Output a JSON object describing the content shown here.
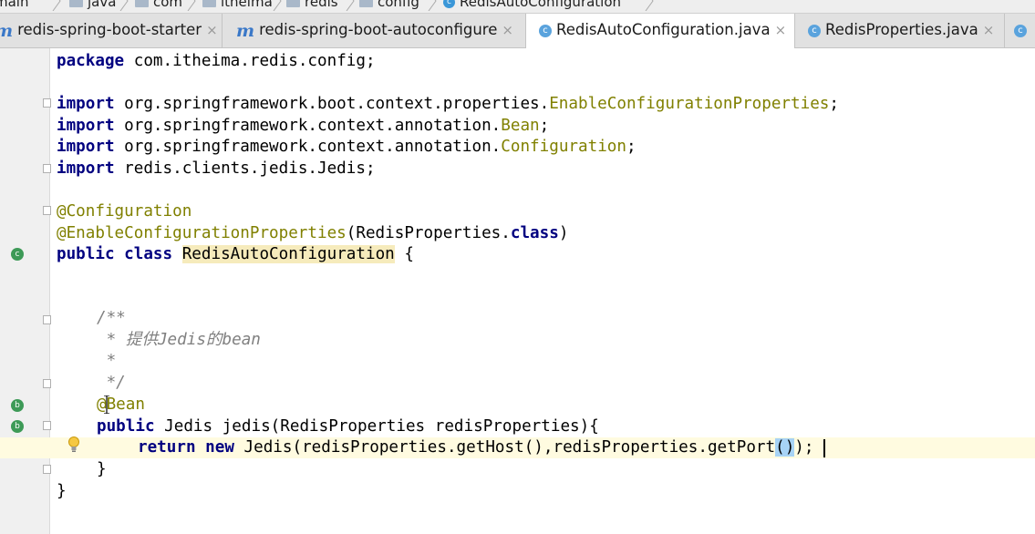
{
  "breadcrumb": {
    "items": [
      {
        "label": "main",
        "icon": "folder-icon"
      },
      {
        "label": "java",
        "icon": "folder-icon"
      },
      {
        "label": "com",
        "icon": "folder-icon"
      },
      {
        "label": "itheima",
        "icon": "folder-icon"
      },
      {
        "label": "redis",
        "icon": "folder-icon"
      },
      {
        "label": "config",
        "icon": "folder-icon"
      },
      {
        "label": "RedisAutoConfiguration",
        "icon": "class-icon"
      }
    ]
  },
  "tabs": [
    {
      "label": "redis-spring-boot-starter",
      "icon": "maven-module-icon",
      "close": "×"
    },
    {
      "label": "redis-spring-boot-autoconfigure",
      "icon": "maven-module-icon",
      "close": "×"
    },
    {
      "label": "RedisAutoConfiguration.java",
      "icon": "class-icon",
      "close": "×",
      "active": true
    },
    {
      "label": "RedisProperties.java",
      "icon": "class-icon",
      "close": "×"
    }
  ],
  "code": {
    "package_kw": "package",
    "package_name": " com.itheima.redis.config;",
    "import_kw": "import",
    "imp1_pre": " org.springframework.boot.context.properties.",
    "imp1_cls": "EnableConfigurationProperties",
    "imp2_pre": " org.springframework.context.annotation.",
    "imp2_cls": "Bean",
    "imp3_pre": " org.springframework.context.annotation.",
    "imp3_cls": "Configuration",
    "imp4": " redis.clients.jedis.Jedis;",
    "semicolon": ";",
    "ann_config": "@Configuration",
    "ann_enable": "@EnableConfigurationProperties",
    "ann_enable_args": "(RedisProperties.",
    "class_kw": "class",
    "ann_enable_end": ")",
    "public_kw": "public",
    "class_name": "RedisAutoConfiguration",
    "open_brace": " {",
    "cmt1": "/**",
    "cmt2": " * 提供Jedis的bean",
    "cmt3": " *",
    "cmt4": " */",
    "ann_bean": "@Bean",
    "method_sig": " Jedis jedis(RedisProperties redisProperties){",
    "return_kw": "return",
    "new_kw": "new",
    "return_body": " Jedis(redisProperties.getHost(),redisProperties.getPort",
    "paren_pair": "()",
    "return_end": ");",
    "close_inner": "}",
    "close_outer": "}"
  }
}
